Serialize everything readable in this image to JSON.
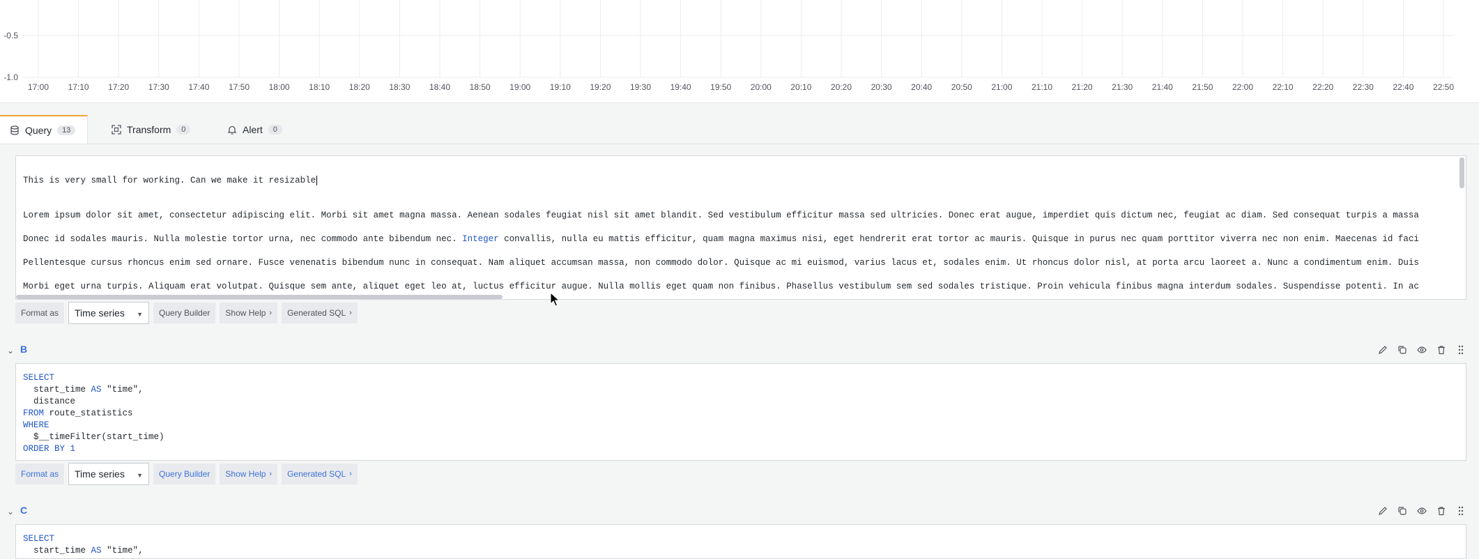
{
  "chart": {
    "y_ticks": [
      "-0.5",
      "-1.0"
    ],
    "x_ticks": [
      "17:00",
      "17:10",
      "17:20",
      "17:30",
      "17:40",
      "17:50",
      "18:00",
      "18:10",
      "18:20",
      "18:30",
      "18:40",
      "18:50",
      "19:00",
      "19:10",
      "19:20",
      "19:30",
      "19:40",
      "19:50",
      "20:00",
      "20:10",
      "20:20",
      "20:30",
      "20:40",
      "20:50",
      "21:00",
      "21:10",
      "21:20",
      "21:30",
      "21:40",
      "21:50",
      "22:00",
      "22:10",
      "22:20",
      "22:30",
      "22:40",
      "22:50"
    ]
  },
  "tabs": [
    {
      "label": "Query",
      "count": "13",
      "icon": "database-icon"
    },
    {
      "label": "Transform",
      "count": "0",
      "icon": "transform-icon"
    },
    {
      "label": "Alert",
      "count": "0",
      "icon": "bell-icon"
    }
  ],
  "queryA": {
    "line1": "This is very small for working. Can we make it resizable",
    "lorem": [
      "Lorem ipsum dolor sit amet, consectetur adipiscing elit. Morbi sit amet magna massa. Aenean sodales feugiat nisl sit amet blandit. Sed vestibulum efficitur massa sed ultricies. Donec erat augue, imperdiet quis dictum nec, feugiat ac diam. Sed consequat turpis a massa",
      "Pellentesque cursus rhoncus enim sed ornare. Fusce venenatis bibendum nunc in consequat. Nam aliquet accumsan massa, non commodo dolor. Quisque ac mi euismod, varius lacus et, sodales enim. Ut rhoncus dolor nisl, at porta arcu laoreet a. Nunc a condimentum enim. Duis",
      "Morbi eget urna turpis. Aliquam erat volutpat. Quisque sem ante, aliquet eget leo at, luctus efficitur augue. Nulla mollis eget quam non finibus. Phasellus vestibulum sem sed sodales tristique. Proin vehicula finibus magna interdum sodales. Suspendisse potenti. In ac"
    ],
    "line2_before": "Donec id sodales mauris. Nulla molestie tortor urna, nec commodo ante bibendum nec. ",
    "line2_keyword": "Integer",
    "line2_after": " convallis, nulla eu mattis efficitur, quam magna maximus nisi, eget hendrerit erat tortor ac mauris. Quisque in purus nec quam porttitor viverra nec non enim. Maecenas id faci",
    "options": {
      "format_label": "Format as",
      "format_value": "Time series",
      "builder": "Query Builder",
      "help": "Show Help",
      "sql": "Generated SQL"
    }
  },
  "queryB": {
    "name": "B",
    "sql": {
      "select": "SELECT",
      "col1": "start_time",
      "as": "AS",
      "alias": "\"time\",",
      "col2": "distance",
      "from": "FROM",
      "table": "route_statistics",
      "where": "WHERE",
      "filter": "$__timeFilter(start_time)",
      "order": "ORDER BY",
      "order_num": "1"
    },
    "options": {
      "format_label": "Format as",
      "format_value": "Time series",
      "builder": "Query Builder",
      "help": "Show Help",
      "sql": "Generated SQL"
    }
  },
  "queryC": {
    "name": "C",
    "select": "SELECT",
    "col1": "start_time",
    "as": "AS",
    "alias": "\"time\","
  }
}
